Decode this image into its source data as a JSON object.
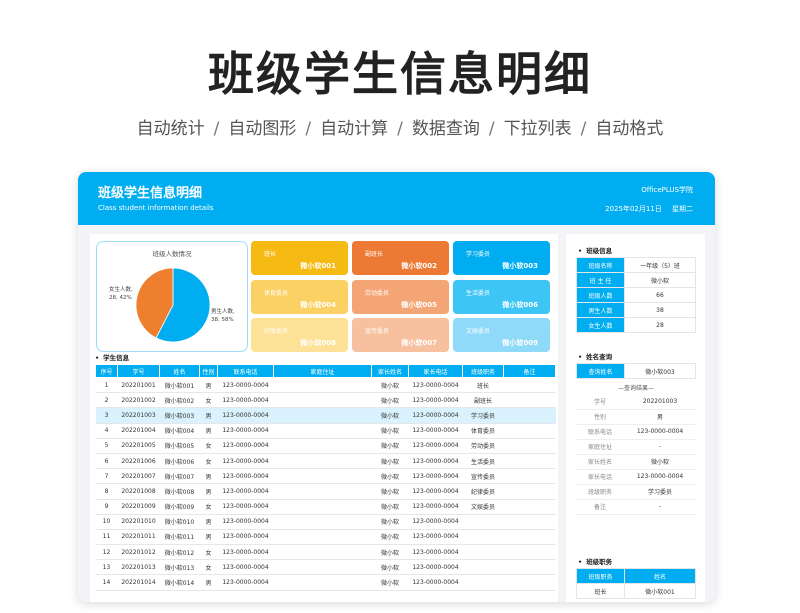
{
  "hero": {
    "title": "班级学生信息明细",
    "features": [
      "自动统计",
      "自动图形",
      "自动计算",
      "数据查询",
      "下拉列表",
      "自动格式"
    ],
    "separator": "/"
  },
  "banner": {
    "title": "班级学生信息明细",
    "subtitle": "Class student information details",
    "org": "OfficePLUS学院",
    "date": "2025年02月11日",
    "weekday": "星期二"
  },
  "chart_data": {
    "type": "pie",
    "title": "班级人数情况",
    "slices": [
      {
        "name": "男生人数",
        "value": 38,
        "pct": "58%",
        "label": "男生人数,\n38, 58%",
        "color": "#00adf0"
      },
      {
        "name": "女生人数",
        "value": 28,
        "pct": "42%",
        "label": "女生人数,\n28, 42%",
        "color": "#ee7f2e"
      }
    ]
  },
  "cadres": [
    {
      "role": "班长",
      "name": "微小软001",
      "color": "#f6ba14"
    },
    {
      "role": "副班长",
      "name": "微小软002",
      "color": "#ec7a35"
    },
    {
      "role": "学习委员",
      "name": "微小软003",
      "color": "#00adf0"
    },
    {
      "role": "体育委员",
      "name": "微小软004",
      "color": "#fcd164"
    },
    {
      "role": "劳动委员",
      "name": "微小软005",
      "color": "#f4a575"
    },
    {
      "role": "生活委员",
      "name": "微小软006",
      "color": "#3dc5f5"
    },
    {
      "role": "纪律委员",
      "name": "微小软008",
      "color": "#fde196"
    },
    {
      "role": "宣传委员",
      "name": "微小软007",
      "color": "#f7c19f"
    },
    {
      "role": "文娱委员",
      "name": "微小软009",
      "color": "#8fdaf8"
    }
  ],
  "students": {
    "section": "学生信息",
    "headers": [
      "序号",
      "学号",
      "姓名",
      "性别",
      "联系电话",
      "家庭住址",
      "家长姓名",
      "家长电话",
      "班级职务",
      "备注"
    ],
    "rows": [
      [
        "1",
        "202201001",
        "微小软001",
        "男",
        "123-0000-0004",
        "",
        "微小软",
        "123-0000-0004",
        "班长",
        ""
      ],
      [
        "2",
        "202201002",
        "微小软002",
        "女",
        "123-0000-0004",
        "",
        "微小软",
        "123-0000-0004",
        "副班长",
        ""
      ],
      [
        "3",
        "202201003",
        "微小软003",
        "男",
        "123-0000-0004",
        "",
        "微小软",
        "123-0000-0004",
        "学习委员",
        ""
      ],
      [
        "4",
        "202201004",
        "微小软004",
        "男",
        "123-0000-0004",
        "",
        "微小软",
        "123-0000-0004",
        "体育委员",
        ""
      ],
      [
        "5",
        "202201005",
        "微小软005",
        "女",
        "123-0000-0004",
        "",
        "微小软",
        "123-0000-0004",
        "劳动委员",
        ""
      ],
      [
        "6",
        "202201006",
        "微小软006",
        "女",
        "123-0000-0004",
        "",
        "微小软",
        "123-0000-0004",
        "生活委员",
        ""
      ],
      [
        "7",
        "202201007",
        "微小软007",
        "男",
        "123-0000-0004",
        "",
        "微小软",
        "123-0000-0004",
        "宣传委员",
        ""
      ],
      [
        "8",
        "202201008",
        "微小软008",
        "男",
        "123-0000-0004",
        "",
        "微小软",
        "123-0000-0004",
        "纪律委员",
        ""
      ],
      [
        "9",
        "202201009",
        "微小软009",
        "女",
        "123-0000-0004",
        "",
        "微小软",
        "123-0000-0004",
        "文娱委员",
        ""
      ],
      [
        "10",
        "202201010",
        "微小软010",
        "男",
        "123-0000-0004",
        "",
        "微小软",
        "123-0000-0004",
        "",
        ""
      ],
      [
        "11",
        "202201011",
        "微小软011",
        "男",
        "123-0000-0004",
        "",
        "微小软",
        "123-0000-0004",
        "",
        ""
      ],
      [
        "12",
        "202201012",
        "微小软012",
        "女",
        "123-0000-0004",
        "",
        "微小软",
        "123-0000-0004",
        "",
        ""
      ],
      [
        "13",
        "202201013",
        "微小软013",
        "女",
        "123-0000-0004",
        "",
        "微小软",
        "123-0000-0004",
        "",
        ""
      ],
      [
        "14",
        "202201014",
        "微小软014",
        "男",
        "123-0000-0004",
        "",
        "微小软",
        "123-0000-0004",
        "",
        ""
      ]
    ]
  },
  "class_info": {
    "section": "班级信息",
    "rows": [
      {
        "k": "班级名称",
        "v": "一年级（5）班"
      },
      {
        "k": "班 主 任",
        "v": "微小软"
      },
      {
        "k": "班级人数",
        "v": "66"
      },
      {
        "k": "男生人数",
        "v": "38"
      },
      {
        "k": "女生人数",
        "v": "28"
      }
    ]
  },
  "query": {
    "section": "姓名查询",
    "label": "查询姓名",
    "value": "微小软003",
    "result_title": "—查询结果—",
    "rows": [
      {
        "k": "学号",
        "v": "202201003"
      },
      {
        "k": "性别",
        "v": "男"
      },
      {
        "k": "联系电话",
        "v": "123-0000-0004"
      },
      {
        "k": "家庭住址",
        "v": "-"
      },
      {
        "k": "家长姓名",
        "v": "微小软"
      },
      {
        "k": "家长电话",
        "v": "123-0000-0004"
      },
      {
        "k": "班级职务",
        "v": "学习委员"
      },
      {
        "k": "备注",
        "v": "-"
      }
    ]
  },
  "duties": {
    "section": "班级职务",
    "headers": [
      "班级职务",
      "姓名"
    ],
    "rows": [
      {
        "k": "班长",
        "v": "微小软001"
      }
    ]
  }
}
